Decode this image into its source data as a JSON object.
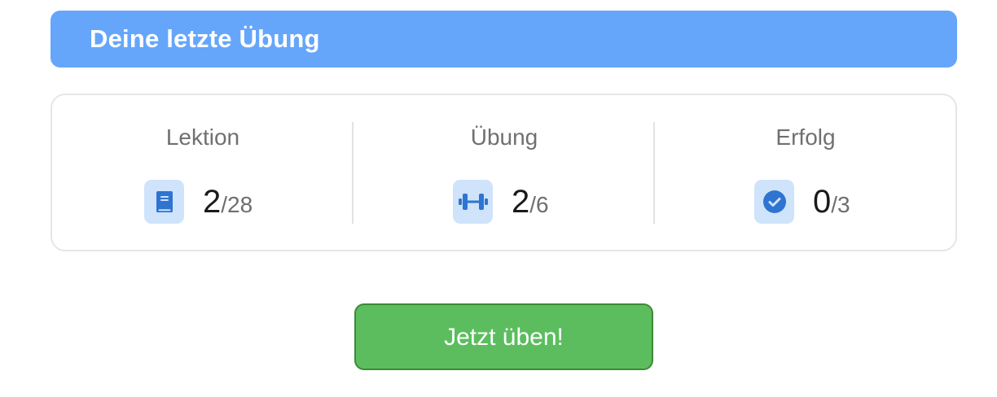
{
  "header": {
    "title": "Deine letzte Übung"
  },
  "stats": [
    {
      "label": "Lektion",
      "icon": "book-icon",
      "value": "2",
      "total": "/28"
    },
    {
      "label": "Übung",
      "icon": "dumbbell-icon",
      "value": "2",
      "total": "/6"
    },
    {
      "label": "Erfolg",
      "icon": "check-circle-icon",
      "value": "0",
      "total": "/3"
    }
  ],
  "cta": {
    "label": "Jetzt üben!"
  },
  "colors": {
    "header_bg": "#66a6fa",
    "icon_bg": "#cfe3fb",
    "icon_fg": "#2f74d0",
    "cta_bg": "#5cbd5f",
    "cta_border": "#3d8a35"
  }
}
